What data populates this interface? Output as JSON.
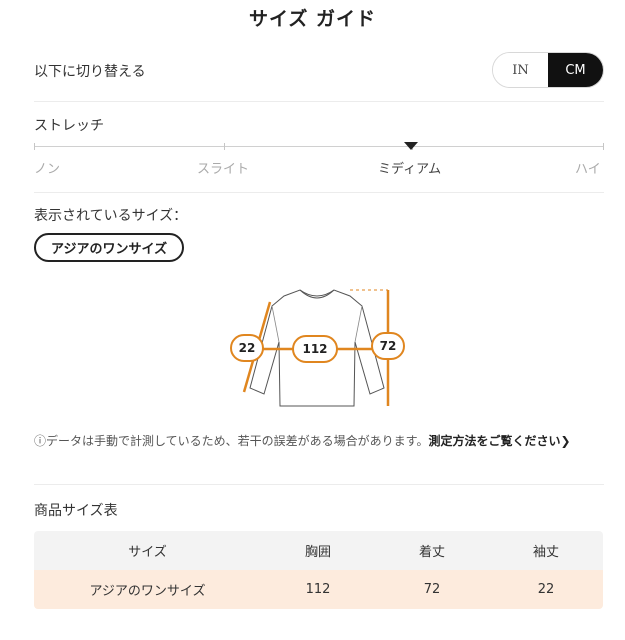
{
  "header": {
    "title": "サイズ ガイド"
  },
  "units": {
    "label": "以下に切り替える",
    "options": [
      "IN",
      "CM"
    ],
    "selected": "CM"
  },
  "stretch": {
    "label": "ストレッチ",
    "options": [
      "ノン",
      "スライト",
      "ミディアム",
      "ハイ"
    ],
    "selected": "ミディアム"
  },
  "displayed_size": {
    "label": "表示されているサイズ：",
    "value": "アジアのワンサイズ"
  },
  "diagram": {
    "sleeve": "22",
    "chest": "112",
    "length": "72",
    "accent_color": "#e0861f"
  },
  "note": {
    "text": "ⓘデータは手動で計測しているため、若干の誤差がある場合があります。",
    "link": "測定方法をご覧ください"
  },
  "table": {
    "label": "商品サイズ表",
    "headers": [
      "サイズ",
      "胸囲",
      "着丈",
      "袖丈"
    ],
    "rows": [
      [
        "アジアのワンサイズ",
        "112",
        "72",
        "22"
      ]
    ]
  }
}
